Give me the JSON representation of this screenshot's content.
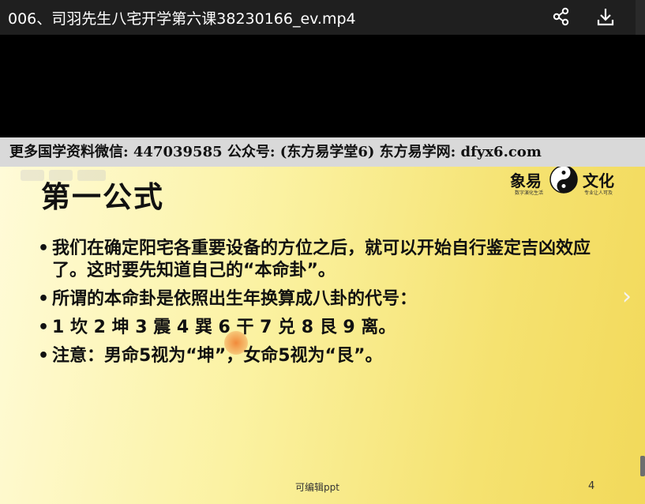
{
  "window": {
    "title": "006、司羽先生八宅开学第六课38230166_ev.mp4",
    "icons": [
      "share-icon",
      "download-icon"
    ]
  },
  "banner": {
    "text": "更多国学资料微信: 447039585 公众号: (东方易学堂6) 东方易学网: dfyx6.com"
  },
  "slide": {
    "title": "第一公式",
    "brand": {
      "left": "象易",
      "right": "文化",
      "left_sub": "数字演化生活",
      "right_sub": "专业让人可及"
    },
    "bullets": [
      "我们在确定阳宅各重要设备的方位之后，就可以开始自行鉴定吉凶效应了。这时要先知道自己的“本命卦”。",
      "所谓的本命卦是依照出生年换算成八卦的代号：",
      "1 坎 2 坤 3 震 4 巽 6 干 7 兑 8 艮 9 离。",
      "注意：男命5视为“坤”，女命5视为“艮”。"
    ],
    "footer": "可编辑ppt",
    "page_number": "4"
  },
  "colors": {
    "titlebar": "#1f1f1f",
    "banner": "#d9d9d9",
    "slide_yellow": "#f5e270"
  }
}
